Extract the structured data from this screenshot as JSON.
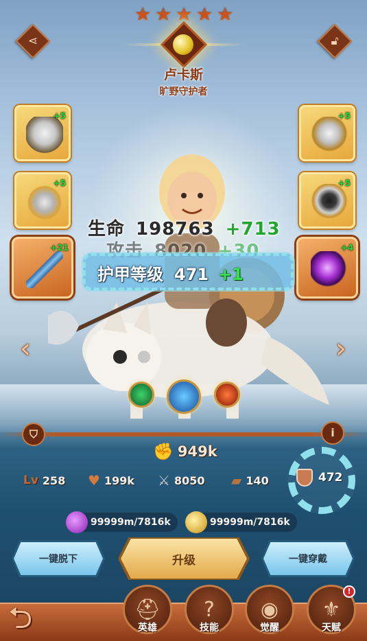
{
  "hero": {
    "name": "卢卡斯",
    "title": "旷野守护者",
    "stars": 5
  },
  "gear_slots": [
    {
      "name": "helmet",
      "level": "+5"
    },
    {
      "name": "chest",
      "level": "+5"
    },
    {
      "name": "weapon",
      "level": "+21"
    },
    {
      "name": "armor",
      "level": "+5"
    },
    {
      "name": "helm",
      "level": "+5"
    },
    {
      "name": "gem",
      "level": "+4"
    }
  ],
  "stat_popup": {
    "hp_label": "生命",
    "hp_value": "198763",
    "hp_plus": "+713",
    "atk_label": "攻击",
    "atk_value": "8020",
    "atk_plus": "+30",
    "armor_label": "护甲等级",
    "armor_value": "471",
    "armor_plus": "+1"
  },
  "combat_power": "949k",
  "stats": {
    "level_label": "Lv",
    "level": "258",
    "hp": "199k",
    "attack": "8050",
    "speed": "140",
    "armor": "472"
  },
  "currencies": {
    "essence": "99999m/7816k",
    "gold": "99999m/7816k"
  },
  "buttons": {
    "unequip_all": "一键脱下",
    "upgrade": "升级",
    "equip_all": "一键穿戴"
  },
  "nav": {
    "hero": "英雄",
    "skills": "技能",
    "awaken": "觉醒",
    "talent": "天赋",
    "talent_badge": "!"
  },
  "colors": {
    "highlight": "#8fe0ea",
    "plus_green": "#33e34a",
    "accent_orange": "#c86d3d"
  }
}
